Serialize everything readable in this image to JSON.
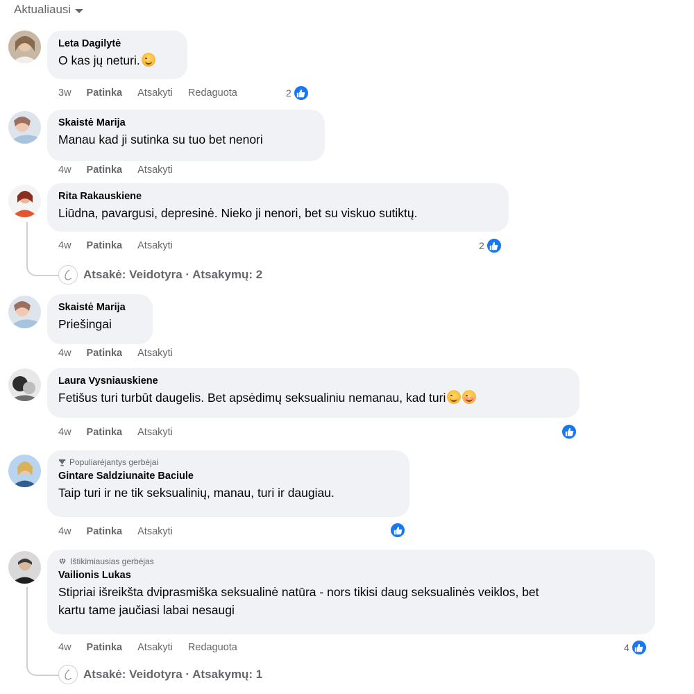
{
  "sort": {
    "label": "Aktualiausi"
  },
  "comments": [
    {
      "author": "Leta Dagilytė",
      "text": "O kas jų neturi.",
      "time": "3w",
      "like": "Patinka",
      "reply": "Atsakyti",
      "edited": "Redaguota",
      "reactions": "2"
    },
    {
      "author": "Skaistė Marija",
      "text": "Manau kad ji sutinka su tuo bet nenori",
      "time": "4w",
      "like": "Patinka",
      "reply": "Atsakyti"
    },
    {
      "author": "Rita Rakauskiene",
      "text": "Liūdna, pavargusi, depresinė. Nieko ji nenori, bet su viskuo sutiktų.",
      "time": "4w",
      "like": "Patinka",
      "reply": "Atsakyti",
      "reactions": "2",
      "replies": "Atsakė: Veidotyra · Atsakymų: 2"
    },
    {
      "author": "Skaistė Marija",
      "text": "Priešingai",
      "time": "4w",
      "like": "Patinka",
      "reply": "Atsakyti"
    },
    {
      "author": "Laura Vysniauskiene",
      "text": "Fetišus turi turbūt daugelis. Bet apsėdimų seksualiniu nemanau, kad turi",
      "time": "4w",
      "like": "Patinka",
      "reply": "Atsakyti"
    },
    {
      "badge": "Populiarėjantys gerbėjai",
      "author": "Gintare Saldziunaite Baciule",
      "text": "Taip turi ir ne tik seksualinių, manau, turi ir daugiau.",
      "time": "4w",
      "like": "Patinka",
      "reply": "Atsakyti"
    },
    {
      "badge": "Ištikimiausias gerbėjas",
      "author": "Vailionis Lukas",
      "text_line1": "Stipriai išreikšta dviprasmiška seksualinė natūra - nors tikisi daug seksualinės veiklos, bet",
      "text_line2": "kartu tame jaučiasi labai nesaugi",
      "time": "4w",
      "like": "Patinka",
      "reply": "Atsakyti",
      "edited": "Redaguota",
      "reactions": "4",
      "replies": "Atsakė: Veidotyra · Atsakymų: 1"
    }
  ],
  "colors": {
    "bubble": "#f0f2f5",
    "like_blue": "#1877f2",
    "meta_gray": "#65676b"
  },
  "icons": {
    "like": "thumbs-up-icon",
    "sort": "caret-down-icon",
    "fan_rising": "trophy-icon",
    "fan_top": "diamond-icon"
  }
}
